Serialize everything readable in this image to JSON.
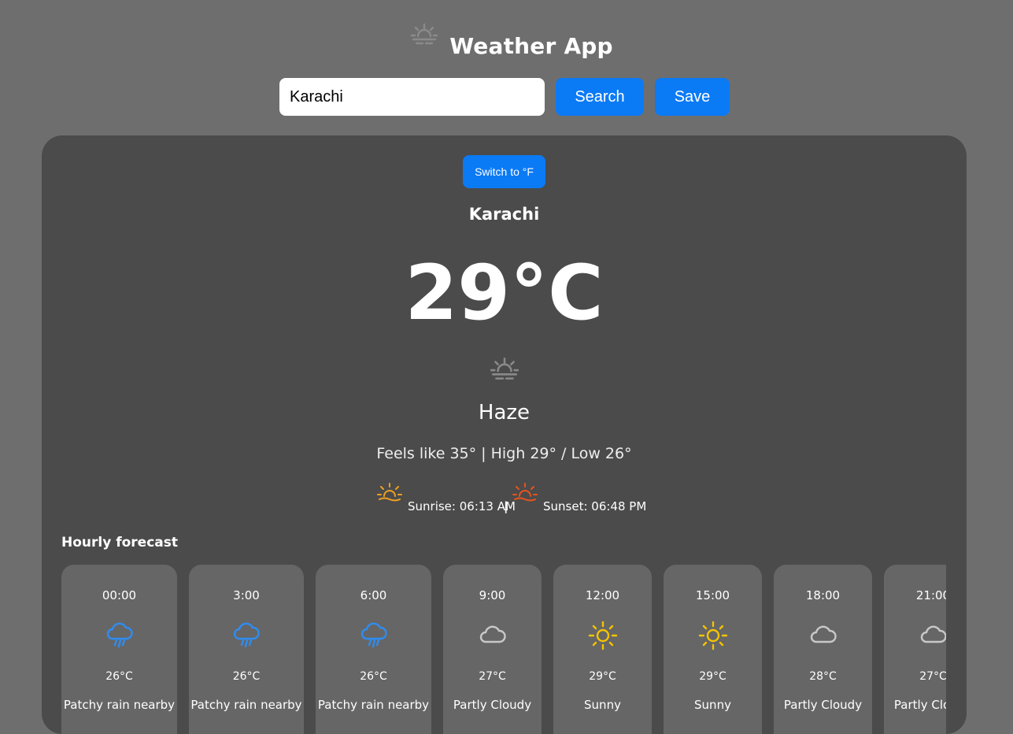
{
  "header": {
    "logo_icon": "haze-icon",
    "title": "Weather App"
  },
  "search": {
    "value": "Karachi",
    "placeholder": "",
    "search_label": "Search",
    "save_label": "Save"
  },
  "current": {
    "unit_toggle_label": "Switch to °F",
    "city": "Karachi",
    "temperature": "29°C",
    "icon": "haze-icon",
    "condition": "Haze",
    "details": "Feels like 35° | High 29° / Low 26°",
    "sunrise_icon": "sunrise-icon",
    "sunrise": "Sunrise: 06:13 AM",
    "separator": "|",
    "sunset_icon": "sunset-icon",
    "sunset": "Sunset: 06:48 PM"
  },
  "hourly": {
    "title": "Hourly forecast",
    "items": [
      {
        "time": "00:00",
        "icon": "rain-icon",
        "temp": "26°C",
        "condition": "Patchy rain nearby"
      },
      {
        "time": "3:00",
        "icon": "rain-icon",
        "temp": "26°C",
        "condition": "Patchy rain nearby"
      },
      {
        "time": "6:00",
        "icon": "rain-icon",
        "temp": "26°C",
        "condition": "Patchy rain nearby"
      },
      {
        "time": "9:00",
        "icon": "cloud-icon",
        "temp": "27°C",
        "condition": "Partly Cloudy"
      },
      {
        "time": "12:00",
        "icon": "sun-icon",
        "temp": "29°C",
        "condition": "Sunny"
      },
      {
        "time": "15:00",
        "icon": "sun-icon",
        "temp": "29°C",
        "condition": "Sunny"
      },
      {
        "time": "18:00",
        "icon": "cloud-icon",
        "temp": "28°C",
        "condition": "Partly Cloudy"
      },
      {
        "time": "21:00",
        "icon": "cloud-icon",
        "temp": "27°C",
        "condition": "Partly Cloudy"
      }
    ]
  },
  "colors": {
    "page_background": "#6e6e6e",
    "card_background": "#4b4b4b",
    "hour_card_background": "#666666",
    "accent": "#0b7af5",
    "rain_icon": "#2f8cf0",
    "sun_icon": "#f5c400",
    "cloud_icon": "#c8c8c8",
    "sunrise_icon": "#f0a020",
    "sunset_icon": "#e8531f"
  }
}
